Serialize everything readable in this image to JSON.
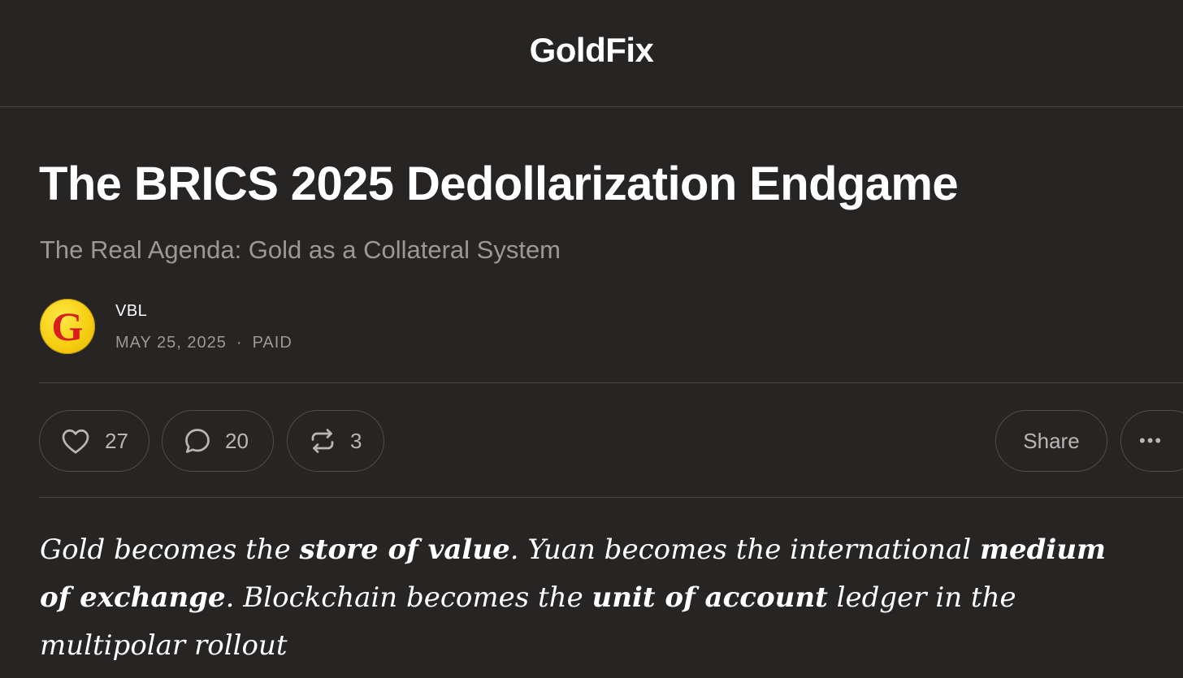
{
  "header": {
    "brand": "GoldFix"
  },
  "post": {
    "title": "The BRICS 2025 Dedollarization Endgame",
    "subtitle": "The Real Agenda: Gold as a Collateral System",
    "author": "VBL",
    "avatar_letter": "G",
    "date": "MAY 25, 2025",
    "separator": "·",
    "access": "PAID"
  },
  "actions": {
    "likes": "27",
    "comments": "20",
    "restacks": "3",
    "share_label": "Share",
    "more_label": "•••"
  },
  "body": {
    "p1_a": "Gold becomes the ",
    "p1_b": "store of value",
    "p1_c": ". Yuan becomes the international ",
    "p1_d": "medium of exchange",
    "p1_e": ". Blockchain becomes the ",
    "p1_f": "unit of account",
    "p1_g": " ledger in the multipolar rollout"
  },
  "colors": {
    "background": "#272424",
    "text_primary": "#ffffff",
    "text_secondary": "#9c9898",
    "border": "#4a4646",
    "avatar_fill": "#f7cf11",
    "avatar_letter": "#d81e1e"
  },
  "icons": [
    "heart-icon",
    "comment-icon",
    "restack-icon",
    "more-icon"
  ]
}
